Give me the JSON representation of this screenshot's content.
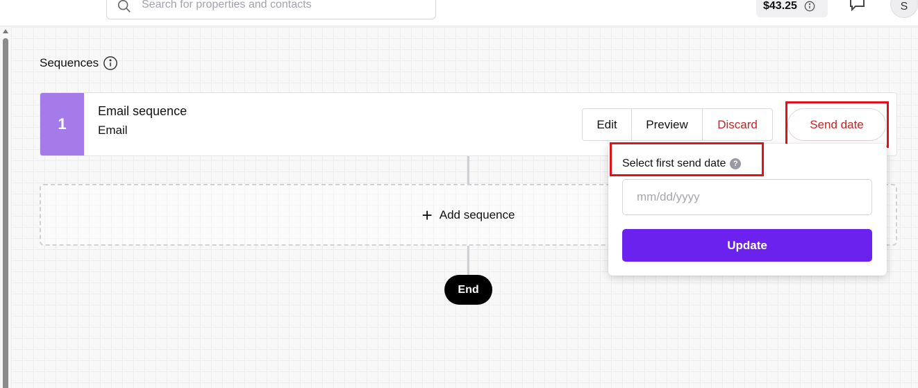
{
  "header": {
    "search_placeholder": "Search for properties and contacts",
    "balance": "$43.25",
    "avatar_initial": "S"
  },
  "sequences": {
    "title": "Sequences",
    "items": [
      {
        "number": "1",
        "title": "Email sequence",
        "type": "Email",
        "actions": {
          "edit": "Edit",
          "preview": "Preview",
          "discard": "Discard",
          "send_date": "Send date"
        }
      }
    ],
    "add_label": "Add sequence",
    "end_label": "End"
  },
  "send_date_popover": {
    "label": "Select first send date",
    "date_placeholder": "mm/dd/yyyy",
    "date_value": "",
    "update_label": "Update"
  },
  "colors": {
    "step_accent": "#a47be9",
    "primary_button": "#6c22ef",
    "danger_text": "#c02525",
    "highlight": "#e0101e"
  }
}
